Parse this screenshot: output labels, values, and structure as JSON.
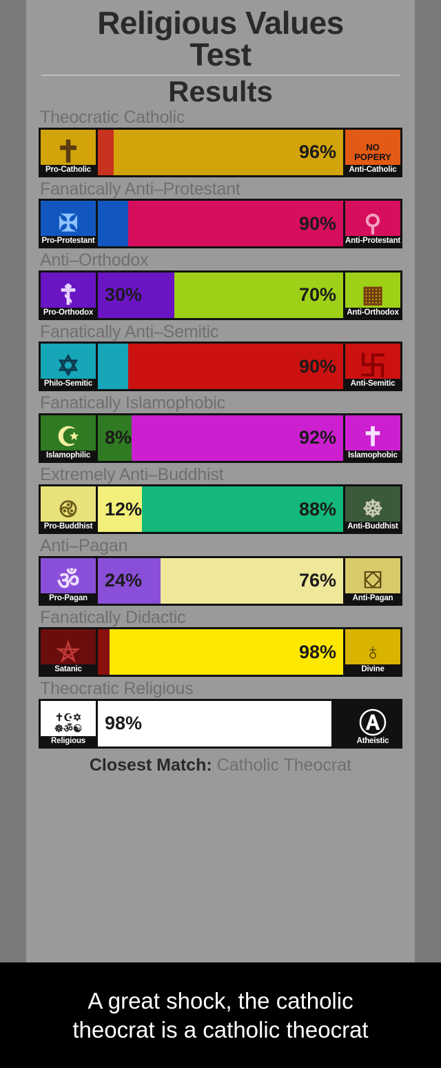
{
  "header": {
    "title_line1": "Religious Values",
    "title_line2": "Test",
    "results": "Results"
  },
  "match": {
    "label": "Closest Match:",
    "value": "Catholic Theocrat"
  },
  "caption": {
    "line1": "A great shock, the catholic",
    "line2": "theocrat is a catholic theocrat"
  },
  "chart_data": {
    "type": "bar",
    "title": "Religious Values Test Results",
    "orientation": "horizontal-diverging",
    "xlabel": "",
    "ylabel": "",
    "axis_range": [
      0,
      100
    ],
    "grid": false,
    "legend": "endcap icons",
    "rows": [
      {
        "label": "Theocratic Catholic",
        "left_label": "Pro-Catholic",
        "right_label": "Anti-Catholic",
        "left_value": 4,
        "right_value": 96,
        "left_text": "",
        "right_text": "96%",
        "left_color": "#c8321e",
        "right_color": "#d2a30a",
        "left_icon": "crucifix-icon",
        "right_icon": "no-popery-icon",
        "left_cap_bg": "#d2a30a",
        "right_cap_bg": "#e25a14"
      },
      {
        "label": "Fanatically Anti–Protestant",
        "left_label": "Pro-Protestant",
        "right_label": "Anti-Protestant",
        "left_value": 10,
        "right_value": 90,
        "left_text": "",
        "right_text": "90%",
        "left_color": "#1257c0",
        "right_color": "#d50f5e",
        "left_icon": "protestant-cross-icon",
        "right_icon": "flag-icon",
        "left_cap_bg": "#1257c0",
        "right_cap_bg": "#d50f5e"
      },
      {
        "label": "Anti–Orthodox",
        "left_label": "Pro-Orthodox",
        "right_label": "Anti-Orthodox",
        "left_value": 30,
        "right_value": 70,
        "left_text": "30%",
        "right_text": "70%",
        "left_color": "#6a15c4",
        "right_color": "#9fd018",
        "left_icon": "orthodox-cross-icon",
        "right_icon": "map-icon",
        "left_cap_bg": "#6a15c4",
        "right_cap_bg": "#9fd018"
      },
      {
        "label": "Fanatically Anti–Semitic",
        "left_label": "Philo-Semitic",
        "right_label": "Anti-Semitic",
        "left_value": 10,
        "right_value": 90,
        "left_text": "",
        "right_text": "90%",
        "left_color": "#17a5b8",
        "right_color": "#cc1111",
        "left_icon": "star-of-david-icon",
        "right_icon": "swastika-icon",
        "left_cap_bg": "#17a5b8",
        "right_cap_bg": "#cc1111"
      },
      {
        "label": "Fanatically Islamophobic",
        "left_label": "Islamophilic",
        "right_label": "Islamophobic",
        "left_value": 8,
        "right_value": 92,
        "left_text": "8%",
        "right_text": "92%",
        "left_color": "#2f7a22",
        "right_color": "#cc1fd0",
        "left_icon": "crescent-star-icon",
        "right_icon": "crusader-shield-icon",
        "left_cap_bg": "#2f7a22",
        "right_cap_bg": "#cc1fd0"
      },
      {
        "label": "Extremely Anti–Buddhist",
        "left_label": "Pro-Buddhist",
        "right_label": "Anti-Buddhist",
        "left_value": 12,
        "right_value": 88,
        "left_text": "12%",
        "right_text": "88%",
        "left_color": "#f2ef7a",
        "right_color": "#13b87a",
        "left_icon": "buddha-icon",
        "right_icon": "destroyed-statue-icon",
        "left_cap_bg": "#e8e27a",
        "right_cap_bg": "#3a5a3a"
      },
      {
        "label": "Anti–Pagan",
        "left_label": "Pro-Pagan",
        "right_label": "Anti-Pagan",
        "left_value": 24,
        "right_value": 76,
        "left_text": "24%",
        "right_text": "76%",
        "left_color": "#8a4fd8",
        "right_color": "#efe79a",
        "left_icon": "pagan-idol-icon",
        "right_icon": "toppled-idol-icon",
        "left_cap_bg": "#8a4fd8",
        "right_cap_bg": "#d8c96a"
      },
      {
        "label": "Fanatically Didactic",
        "left_label": "Satanic",
        "right_label": "Divine",
        "left_value": 2,
        "right_value": 98,
        "left_text": "",
        "right_text": "98%",
        "left_color": "#8b0f0f",
        "right_color": "#ffe800",
        "left_icon": "pentagram-icon",
        "right_icon": "divine-eagle-icon",
        "left_cap_bg": "#6a0d0d",
        "right_cap_bg": "#d8b400"
      },
      {
        "label": "Theocratic Religious",
        "left_label": "Religious",
        "right_label": "Atheistic",
        "left_value": 98,
        "right_value": 2,
        "left_text": "98%",
        "right_text": "",
        "left_color": "#ffffff",
        "right_color": "#111111",
        "left_icon": "religions-symbols-icon",
        "right_icon": "atheist-icon",
        "left_cap_bg": "#ffffff",
        "right_cap_bg": "#111111"
      }
    ]
  }
}
